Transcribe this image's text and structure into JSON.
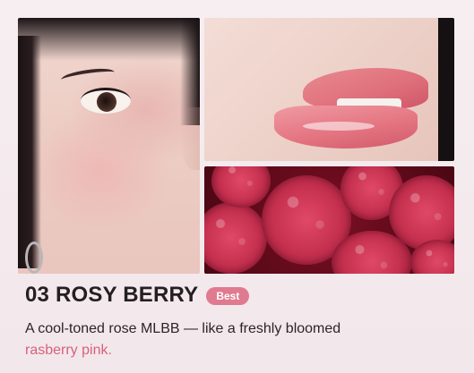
{
  "product": {
    "title": "03 ROSY BERRY",
    "badge": "Best",
    "description_line1": "A cool-toned rose MLBB — like a freshly bloomed",
    "description_highlight": "rasberry pink."
  },
  "photos": [
    {
      "name": "face-closeup-photo"
    },
    {
      "name": "lips-closeup-photo"
    },
    {
      "name": "raspberries-photo"
    }
  ],
  "colors": {
    "accent": "#e07a90",
    "highlight_text": "#d8617b",
    "title_text": "#242022",
    "background": "#f4eaee"
  }
}
